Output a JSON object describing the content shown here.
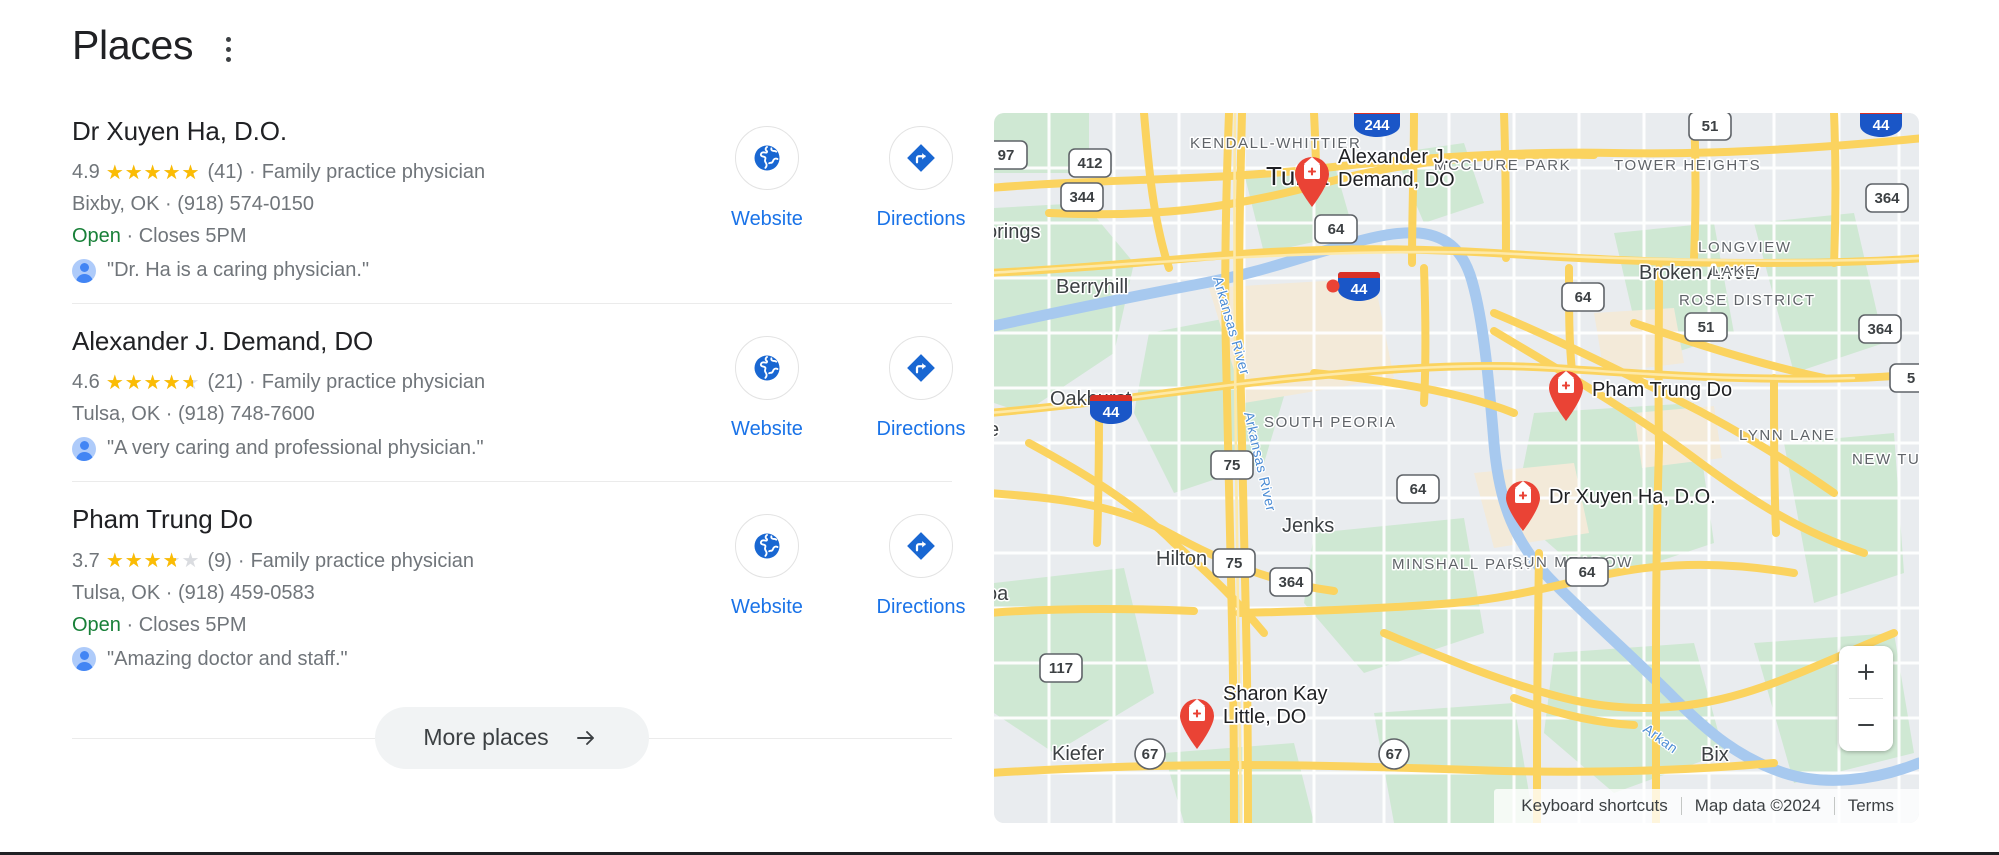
{
  "header": {
    "title": "Places",
    "menu_icon": "kebab-menu-icon"
  },
  "listings": [
    {
      "name": "Dr Xuyen Ha, D.O.",
      "rating": "4.9",
      "rating_value": 4.9,
      "review_count": "(41)",
      "category": "Family practice physician",
      "location": "Bixby, OK · (918) 574-0150",
      "open_label": "Open",
      "hours": "· Closes 5PM",
      "quote": "\"Dr. Ha is a caring physician.\"",
      "website_label": "Website",
      "directions_label": "Directions"
    },
    {
      "name": "Alexander J. Demand, DO",
      "rating": "4.6",
      "rating_value": 4.6,
      "review_count": "(21)",
      "category": "Family practice physician",
      "location": "Tulsa, OK · (918) 748-7600",
      "open_label": "",
      "hours": "",
      "quote": "\"A very caring and professional physician.\"",
      "website_label": "Website",
      "directions_label": "Directions"
    },
    {
      "name": "Pham Trung Do",
      "rating": "3.7",
      "rating_value": 3.7,
      "review_count": "(9)",
      "category": "Family practice physician",
      "location": "Tulsa, OK · (918) 459-0583",
      "open_label": "Open",
      "hours": "· Closes 5PM",
      "quote": "\"Amazing doctor and staff.\"",
      "website_label": "Website",
      "directions_label": "Directions"
    }
  ],
  "more_places": {
    "label": "More places",
    "arrow_icon": "arrow-right-icon"
  },
  "map": {
    "city_labels": [
      "Tulsa"
    ],
    "town_labels": [
      "Berryhill",
      "Oakhurst",
      "Jenks",
      "Hilton",
      "Kiefer",
      "Broken Arrow"
    ],
    "partial_labels": [
      "orings",
      "e",
      "oa",
      "Bix"
    ],
    "neighborhood_labels": [
      "KENDALL-WHITTIER",
      "MCCLURE PARK",
      "TOWER HEIGHTS",
      "LONGVIEW LAKE",
      "LYNN LANE",
      "NEW TUL",
      "SOUTH PEORIA",
      "MINSHALL PARK",
      "SUN MEADOW",
      "ROSE DISTRICT"
    ],
    "river_labels": [
      "Arkansas River",
      "Arkan"
    ],
    "us_shields": [
      "412",
      "344",
      "75",
      "75",
      "364",
      "64",
      "64",
      "64",
      "51",
      "364",
      "364",
      "117",
      "67",
      "67",
      "97",
      "5"
    ],
    "interstate_shields": [
      "244",
      "44",
      "44",
      "44"
    ],
    "pins": [
      {
        "label": "Alexander J.\nDemand, DO",
        "line1": "Alexander J.",
        "line2": "Demand, DO"
      },
      {
        "label": "Pham Trung Do",
        "line1": "Pham Trung Do",
        "line2": ""
      },
      {
        "label": "Dr Xuyen Ha, D.O.",
        "line1": "Dr Xuyen Ha, D.O.",
        "line2": ""
      },
      {
        "label": "Sharon Kay\nLittle, DO",
        "line1": "Sharon Kay",
        "line2": "Little, DO"
      }
    ],
    "zoom_in_label": "+",
    "zoom_out_label": "−",
    "attribution": {
      "keyboard_shortcuts": "Keyboard shortcuts",
      "map_data": "Map data ©2024",
      "terms": "Terms"
    }
  },
  "colors": {
    "link_blue": "#1a73e8",
    "star_gold": "#fbbc04",
    "open_green": "#188038",
    "pin_red": "#ea4335",
    "text_gray": "#70757a",
    "text_dark": "#202124"
  }
}
